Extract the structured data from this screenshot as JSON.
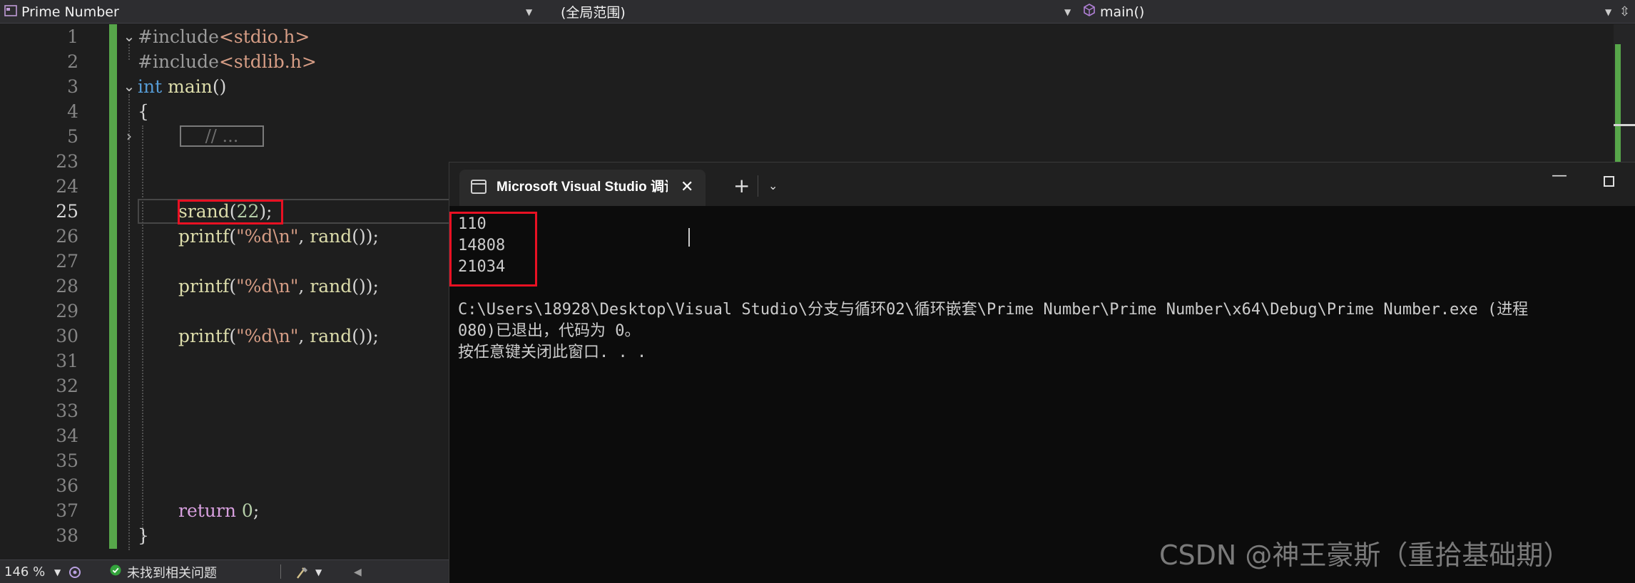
{
  "navbar": {
    "project": "Prime Number",
    "scope": "(全局范围)",
    "member": "main()"
  },
  "editor": {
    "line_numbers": [
      "1",
      "2",
      "3",
      "4",
      "5",
      "23",
      "24",
      "25",
      "26",
      "27",
      "28",
      "29",
      "30",
      "31",
      "32",
      "33",
      "34",
      "35",
      "36",
      "37",
      "38"
    ],
    "code": {
      "l1_directive": "#include",
      "l1_header": "<stdio.h>",
      "l2_directive": "#include",
      "l2_header": "<stdlib.h>",
      "l3_type": "int",
      "l3_name": "main",
      "l3_rest": "()",
      "l4": "{",
      "collapsed": "// ...",
      "l25_fn": "srand",
      "l25_open": "(",
      "l25_num": "22",
      "l25_close": ");",
      "printf_fn": "printf",
      "printf_open": "(",
      "printf_str": "\"%d\\n\"",
      "printf_comma": ", ",
      "printf_call": "rand",
      "printf_close": "());",
      "ret_kw": "return",
      "ret_num": "0",
      "ret_semi": ";",
      "l38": "}"
    }
  },
  "statusbar": {
    "zoom": "146 %",
    "issues": "未找到相关问题"
  },
  "console": {
    "tab_title": "Microsoft Visual Studio 调试控制台",
    "output": [
      "110",
      "14808",
      "21034"
    ],
    "exit_line1": "C:\\Users\\18928\\Desktop\\Visual Studio\\分支与循环02\\循环嵌套\\Prime Number\\Prime Number\\x64\\Debug\\Prime Number.exe (进程",
    "exit_line2": "080)已退出，代码为 0。",
    "exit_line3": "按任意键关闭此窗口. . ."
  },
  "watermark": "CSDN @神王豪斯（重拾基础期）",
  "colors": {
    "change_bar": "#57a64a",
    "highlight_box": "#e81123",
    "keyword": "#569cd6",
    "function": "#dcdcaa",
    "string": "#d69d85"
  }
}
